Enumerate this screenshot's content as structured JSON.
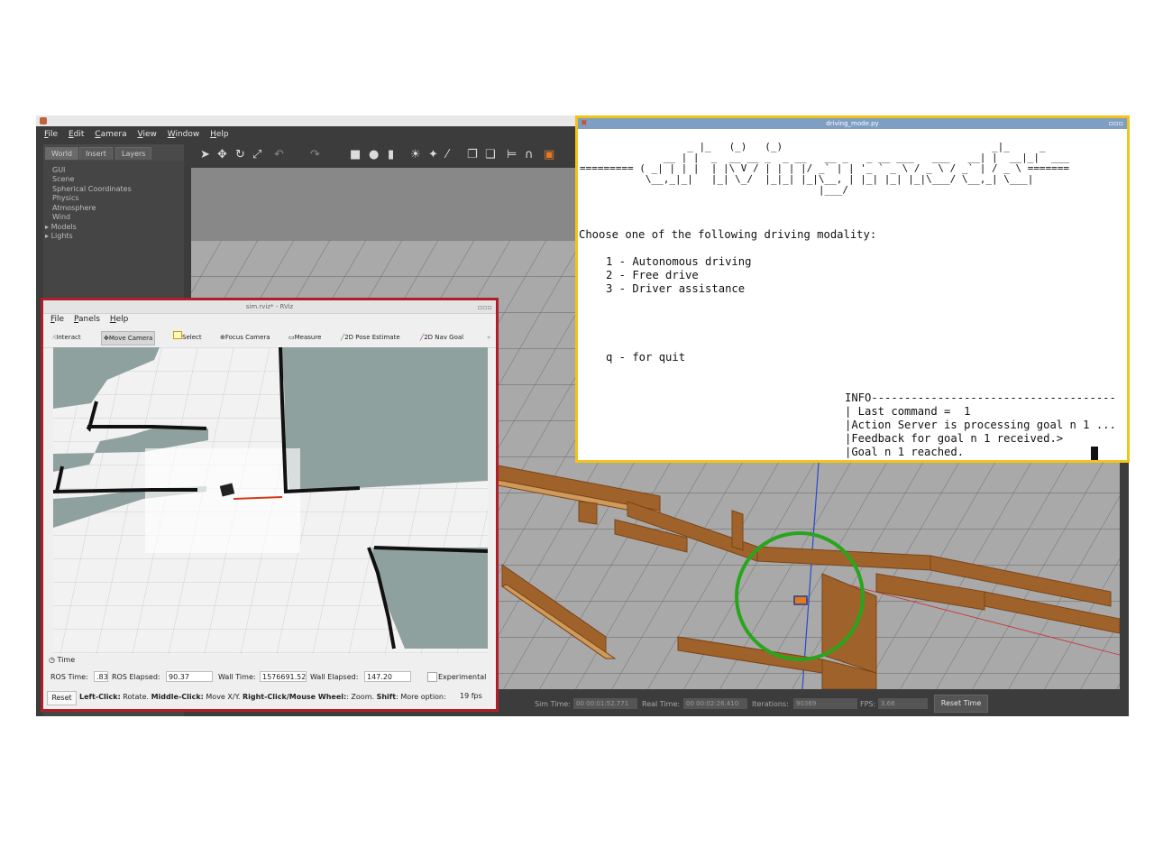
{
  "gazebo": {
    "menu": [
      "File",
      "Edit",
      "Camera",
      "View",
      "Window",
      "Help"
    ],
    "tabs": [
      "World",
      "Insert",
      "Layers"
    ],
    "tree": [
      "GUI",
      "Scene",
      "Spherical Coordinates",
      "Physics",
      "Atmosphere",
      "Wind",
      "Models",
      "Lights"
    ],
    "status": {
      "sim_time_label": "Sim Time:",
      "sim_time": "00 00:01:52.771",
      "real_time_label": "Real Time:",
      "real_time": "00 00:02:26.410",
      "iterations_label": "Iterations:",
      "iterations": "90369",
      "fps_label": "FPS:",
      "fps": "3.66",
      "reset_time": "Reset Time"
    }
  },
  "rviz": {
    "title": "sim.rviz* - RViz",
    "menu": [
      "File",
      "Panels",
      "Help"
    ],
    "tools": [
      "Interact",
      "Move Camera",
      "Select",
      "Focus Camera",
      "Measure",
      "2D Pose Estimate",
      "2D Nav Goal"
    ],
    "time_panel": {
      "header": "Time",
      "ros_time_label": "ROS Time:",
      "ros_time": ".83",
      "ros_elapsed_label": "ROS Elapsed:",
      "ros_elapsed": "90.37",
      "wall_time_label": "Wall Time:",
      "wall_time": "1576691.52",
      "wall_elapsed_label": "Wall Elapsed:",
      "wall_elapsed": "147.20",
      "experimental": "Experimental"
    },
    "statusbar": {
      "reset": "Reset",
      "hint_1b": "Left-Click:",
      "hint_1": " Rotate. ",
      "hint_2b": "Middle-Click:",
      "hint_2": " Move X/Y. ",
      "hint_3b": "Right-Click/Mouse Wheel:",
      "hint_3": ": Zoom. ",
      "hint_4b": "Shift",
      "hint_4": ": More option:",
      "fps": "19 fps"
    }
  },
  "terminal": {
    "title": "driving_mode.py",
    "ascii_art": [
      "                  _ |_   (_)   (_)                                   _|_     _     ",
      "              __ | |  _  __ __ _  _ __   __ _   _ __ ___   ___   __| |  __|_|  ___ ",
      "========= ( _| | | |  | |\\ V / | | | |/ _` | | '_ ` _ \\ / _ \\ / _` | / _ \\ =======",
      "           \\__,_|_|   |_| \\_/  |_|_| |_|\\__, | |_| |_| |_|\\___/ \\__,_| \\___|     ",
      "                                        |___/                                    "
    ],
    "prompt": "Choose one of the following driving modality:",
    "options": [
      "1 - Autonomous driving",
      "2 - Free drive",
      "3 - Driver assistance"
    ],
    "quit": "q - for quit",
    "info_header": "INFO-------------------------------------",
    "info_lines": [
      "| Last command =  1",
      "|Action Server is processing goal n 1 ...",
      "|Feedback for goal n 1 received.>",
      "|Goal n 1 reached."
    ]
  }
}
